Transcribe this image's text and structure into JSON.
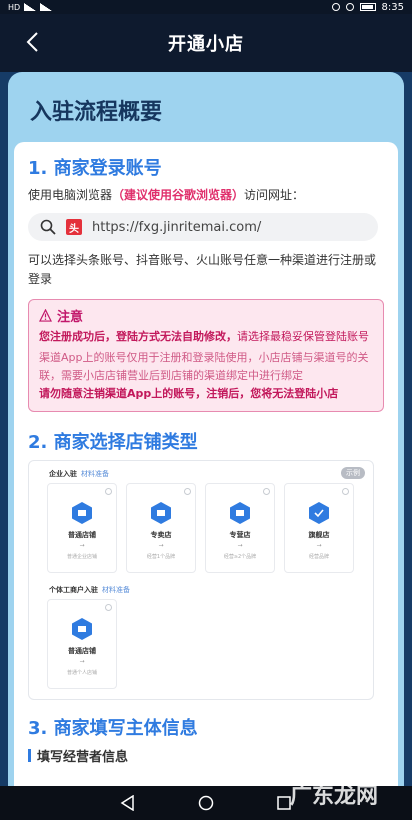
{
  "status_bar": {
    "left_text": "HD",
    "time": "8:35"
  },
  "nav": {
    "title": "开通小店"
  },
  "overview_title": "入驻流程概要",
  "section1": {
    "title": "1. 商家登录账号",
    "intro_prefix": "使用电脑浏览器",
    "intro_highlight": "（建议使用谷歌浏览器）",
    "intro_suffix": "访问网址：",
    "favicon_text": "头",
    "url": "https://fxg.jinritemai.com/",
    "account_note": "可以选择头条账号、抖音账号、火山账号任意一种渠道进行注册或登录"
  },
  "notice": {
    "title": "注意",
    "line1_bold": "您注册成功后，登陆方式无法自助修改，",
    "line1_rest": "请选择最稳妥保管登陆账号",
    "line2": "渠道App上的账号仅用于注册和登录陆使用，小店店铺与渠道号的关联，需要小店店铺营业后到店铺的渠道绑定中进行绑定",
    "line3": "请勿随意注销渠道App上的账号，注销后，您将无法登陆小店"
  },
  "section2": {
    "title": "2. 商家选择店铺类型",
    "enterprise_label": "企业入驻",
    "enterprise_sub": "材料准备",
    "sample_tag": "示例",
    "individual_label": "个体工商户入驻",
    "individual_sub": "材料准备",
    "enterprise_shops": [
      {
        "name": "普通店铺",
        "desc": "普通企业店铺"
      },
      {
        "name": "专卖店",
        "desc": "经营1个品牌"
      },
      {
        "name": "专营店",
        "desc": "经营≥2个品牌"
      },
      {
        "name": "旗舰店",
        "desc": "经营品牌"
      }
    ],
    "individual_shops": [
      {
        "name": "普通店铺",
        "desc": "普通个人店铺"
      }
    ],
    "arrow": "→"
  },
  "section3": {
    "title": "3. 商家填写主体信息",
    "subhead": "填写经营者信息"
  },
  "watermark": "广东龙网",
  "colors": {
    "accent_blue": "#2f7be0",
    "highlight_pink": "#e0306c",
    "card_header_bg": "#9ed3ef",
    "notice_bg": "#fde7ef"
  }
}
